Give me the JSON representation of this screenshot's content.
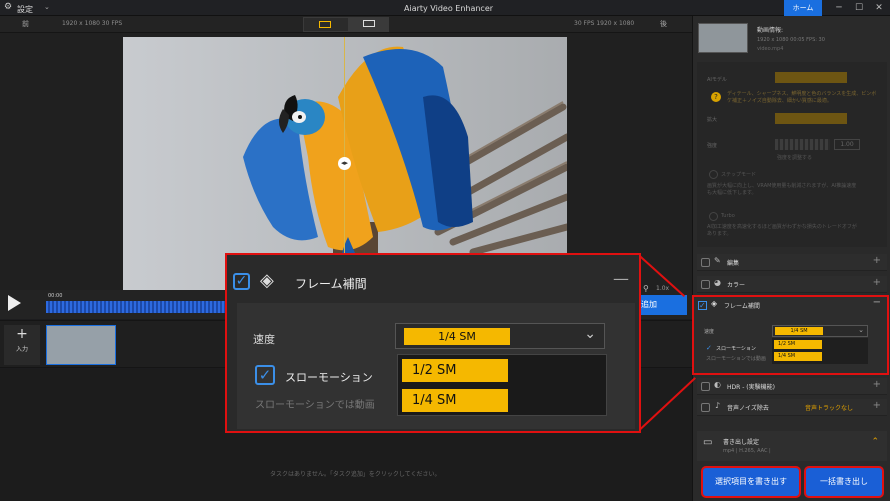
{
  "titlebar": {
    "settings": "設定",
    "title": "Aiarty Video Enhancer",
    "home": "ホーム"
  },
  "compare": {
    "before": "前",
    "after": "後",
    "left_info": "1920 x 1080  30 FPS",
    "right_info": "30 FPS  1920 x 1080"
  },
  "video_info": {
    "heading": "動画情報:",
    "line1": "1920 x 1080  00:05  FPS: 30",
    "line2": "video.mp4"
  },
  "ai_settings": {
    "model_label": "AIモデル",
    "model_desc": "ディテール、シャープネス、鮮明度と色のバランスを生成、ピンボケ補正＋ノイズ自動除去、細かい質感に最適。",
    "scale_label": "拡大",
    "strength_label": "強度",
    "strength_value": "1.00",
    "strength_hint": "強度を調整する",
    "step_mode": "ステップモード",
    "step_desc": "画質が大幅に向上し、VRAM使用量も削減されますが、AI推論速度も大幅に低下します。",
    "turbo": "Turbo",
    "turbo_desc": "AI加工速度を高速化するほど画質がわずかな損失のトレードオフがあります。"
  },
  "sections": {
    "edit": "編集",
    "color": "カラー",
    "frame_interp": "フレーム補間",
    "hdr": "HDR - (実験機能)",
    "denoise": "音声ノイズ除去",
    "denoise_value": "音声トラックなし"
  },
  "frame_panel": {
    "speed_label": "速度",
    "speed_value": "1/4 SM",
    "options": [
      "1/2 SM",
      "1/4 SM"
    ],
    "slow_motion": "スローモーション",
    "slow_note": "スローモーションでは動画"
  },
  "timeline": {
    "timecode": "00:00",
    "add_button": "追加",
    "zoom": "1.0x"
  },
  "clips": {
    "input_label": "入力"
  },
  "tasks": {
    "empty_msg": "タスクはありません。「タスク追加」をクリックしてください。"
  },
  "export": {
    "settings_label": "書き出し設定",
    "format": "mp4 | H.265, AAC |",
    "export_selected": "選択項目を書き出す",
    "export_all": "一括書き出し"
  },
  "colors": {
    "accent": "#1a5fd6",
    "highlight": "#e01010",
    "option": "#f5b800"
  }
}
